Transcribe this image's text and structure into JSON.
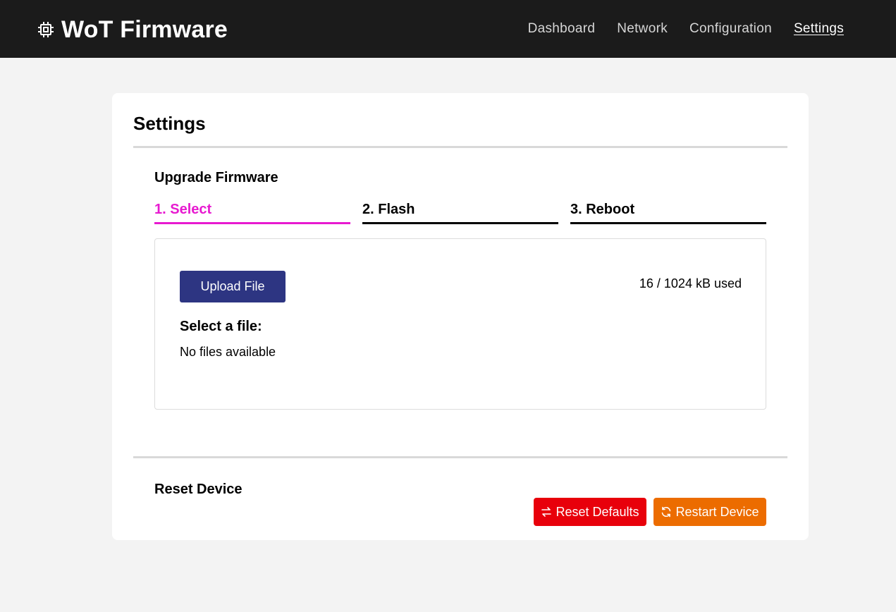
{
  "header": {
    "icon": "chip-icon",
    "title": "WoT Firmware",
    "nav": [
      {
        "label": "Dashboard",
        "active": false
      },
      {
        "label": "Network",
        "active": false
      },
      {
        "label": "Configuration",
        "active": false
      },
      {
        "label": "Settings",
        "active": true
      }
    ]
  },
  "page": {
    "title": "Settings"
  },
  "firmware": {
    "title": "Upgrade Firmware",
    "steps": [
      {
        "label": "1. Select",
        "active": true
      },
      {
        "label": "2. Flash",
        "active": false
      },
      {
        "label": "3. Reboot",
        "active": false
      }
    ],
    "upload_label": "Upload File",
    "usage": "16 / 1024 kB used",
    "select_label": "Select a file:",
    "empty_text": "No files available"
  },
  "reset": {
    "title": "Reset Device",
    "reset_defaults_label": "Reset Defaults",
    "reset_defaults_icon": "swap-arrows-icon",
    "restart_label": "Restart Device",
    "restart_icon": "refresh-icon"
  },
  "colors": {
    "header_bg": "#1b1b1b",
    "active_step": "#e71ad0",
    "upload_button": "#2d3582",
    "reset_button": "#e8000b",
    "restart_button": "#ec6c00"
  }
}
